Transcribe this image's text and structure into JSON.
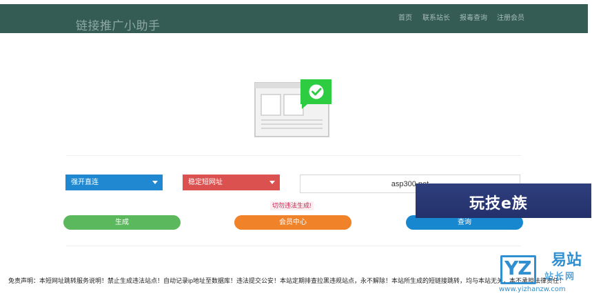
{
  "navbar": {
    "brand": "链接推广小助手",
    "links": [
      "首页",
      "联系站长",
      "报毒查询",
      "注册会员"
    ]
  },
  "form": {
    "mode_select": "强开直连",
    "type_select": "稳定短网址",
    "url_value": "asp300.net",
    "warning": "切勿违法生成!",
    "generate_label": "生成",
    "vip_label": "会员中心",
    "query_label": "查询"
  },
  "overlay_banner": {
    "text": "玩技e族"
  },
  "disclaimer": "免责声明：本短网址跳转服务说明！禁止生成违法站点！自动记录ip地址至数据库！违法提交公安！本站定期排查拉黑违规站点，永不解除！本站所生成的短链接跳转，均与本站无关，本不承担法律责任！",
  "watermark": {
    "logo_letters": "YZ",
    "name_line1": "易站",
    "name_line2": "站长网",
    "url": "www.yizhanzw.com"
  },
  "colors": {
    "navbar": "#345c54",
    "select_blue": "#1f88d0",
    "select_red": "#db514f",
    "btn_green": "#5cb85c",
    "btn_orange": "#f0822a",
    "btn_blue": "#1788cf",
    "check_green": "#2ecc40"
  }
}
